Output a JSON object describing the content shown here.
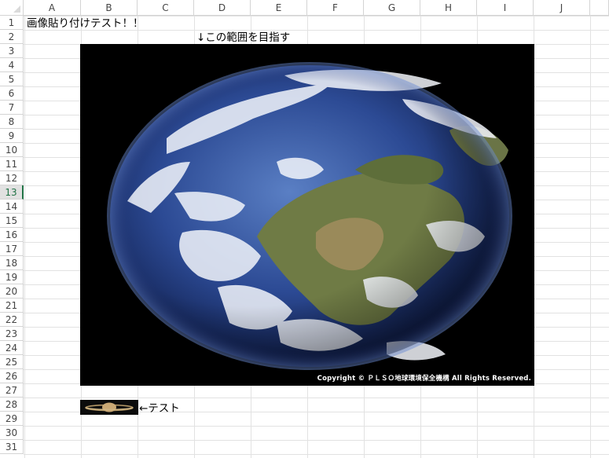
{
  "columns": [
    "A",
    "B",
    "C",
    "D",
    "E",
    "F",
    "G",
    "H",
    "I",
    "J"
  ],
  "rows": [
    "1",
    "2",
    "3",
    "4",
    "5",
    "6",
    "7",
    "8",
    "9",
    "10",
    "11",
    "12",
    "13",
    "14",
    "15",
    "16",
    "17",
    "18",
    "19",
    "20",
    "21",
    "22",
    "23",
    "24",
    "25",
    "26",
    "27",
    "28",
    "29",
    "30",
    "31"
  ],
  "selected_row": "13",
  "cells": {
    "a1": "画像貼り付けテスト！！",
    "d2": "↓この範囲を目指す",
    "c28": "←テスト"
  },
  "earth_image": {
    "copyright": "Copyright © ＰＬＳＯ地球環境保全機構 All Rights Reserved."
  },
  "colors": {
    "selection": "#217346",
    "grid": "#e2e2e2",
    "header_border": "#d4d4d4"
  }
}
